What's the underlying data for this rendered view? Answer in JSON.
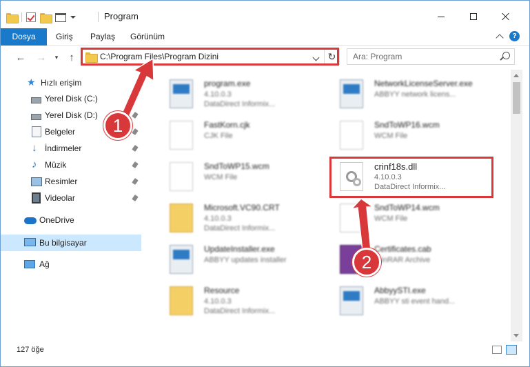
{
  "window": {
    "title": "Program"
  },
  "ribbon": {
    "tabs": [
      "Dosya",
      "Giriş",
      "Paylaş",
      "Görünüm"
    ]
  },
  "nav": {
    "address": "C:\\Program Files\\Program Dizini",
    "search_placeholder": "Ara: Program"
  },
  "sidebar": {
    "quick_access": "Hızlı erişim",
    "items": [
      {
        "label": "Yerel Disk (C:)",
        "icon": "disk-icon"
      },
      {
        "label": "Yerel Disk (D:)",
        "icon": "disk-icon"
      },
      {
        "label": "Belgeler",
        "icon": "documents-icon"
      },
      {
        "label": "İndirmeler",
        "icon": "downloads-icon"
      },
      {
        "label": "Müzik",
        "icon": "music-icon"
      },
      {
        "label": "Resimler",
        "icon": "pictures-icon"
      },
      {
        "label": "Videolar",
        "icon": "videos-icon"
      }
    ],
    "onedrive": "OneDrive",
    "this_pc": "Bu bilgisayar",
    "network": "Ağ"
  },
  "files": [
    {
      "name": "program.exe",
      "sub1": "4.10.0.3",
      "sub2": "DataDirect Informix..."
    },
    {
      "name": "NetworkLicenseServer.exe",
      "sub1": "ABBYY network licens...",
      "sub2": ""
    },
    {
      "name": "FastKorn.cjk",
      "sub1": "CJK File",
      "sub2": ""
    },
    {
      "name": "SndToWP16.wcm",
      "sub1": "WCM File",
      "sub2": ""
    },
    {
      "name": "SndToWP15.wcm",
      "sub1": "WCM File",
      "sub2": ""
    },
    {
      "name": "crinf18s.dll",
      "sub1": "4.10.0.3",
      "sub2": "DataDirect Informix..."
    },
    {
      "name": "Microsoft.VC90.CRT",
      "sub1": "4.10.0.3",
      "sub2": "DataDirect Informix..."
    },
    {
      "name": "SndToWP14.wcm",
      "sub1": "WCM File",
      "sub2": ""
    },
    {
      "name": "UpdateInstaller.exe",
      "sub1": "ABBYY updates installer",
      "sub2": ""
    },
    {
      "name": "Certificates.cab",
      "sub1": "WinRAR Archive",
      "sub2": ""
    },
    {
      "name": "Resource",
      "sub1": "4.10.0.3",
      "sub2": "DataDirect Informix..."
    },
    {
      "name": "AbbyySTI.exe",
      "sub1": "ABBYY sti event hand...",
      "sub2": ""
    }
  ],
  "status": {
    "item_count": "127 öğe"
  },
  "callouts": [
    "1",
    "2"
  ],
  "colors": {
    "accent": "#1979ca",
    "highlight": "#d9383a",
    "selected_bg": "#cce8ff"
  }
}
